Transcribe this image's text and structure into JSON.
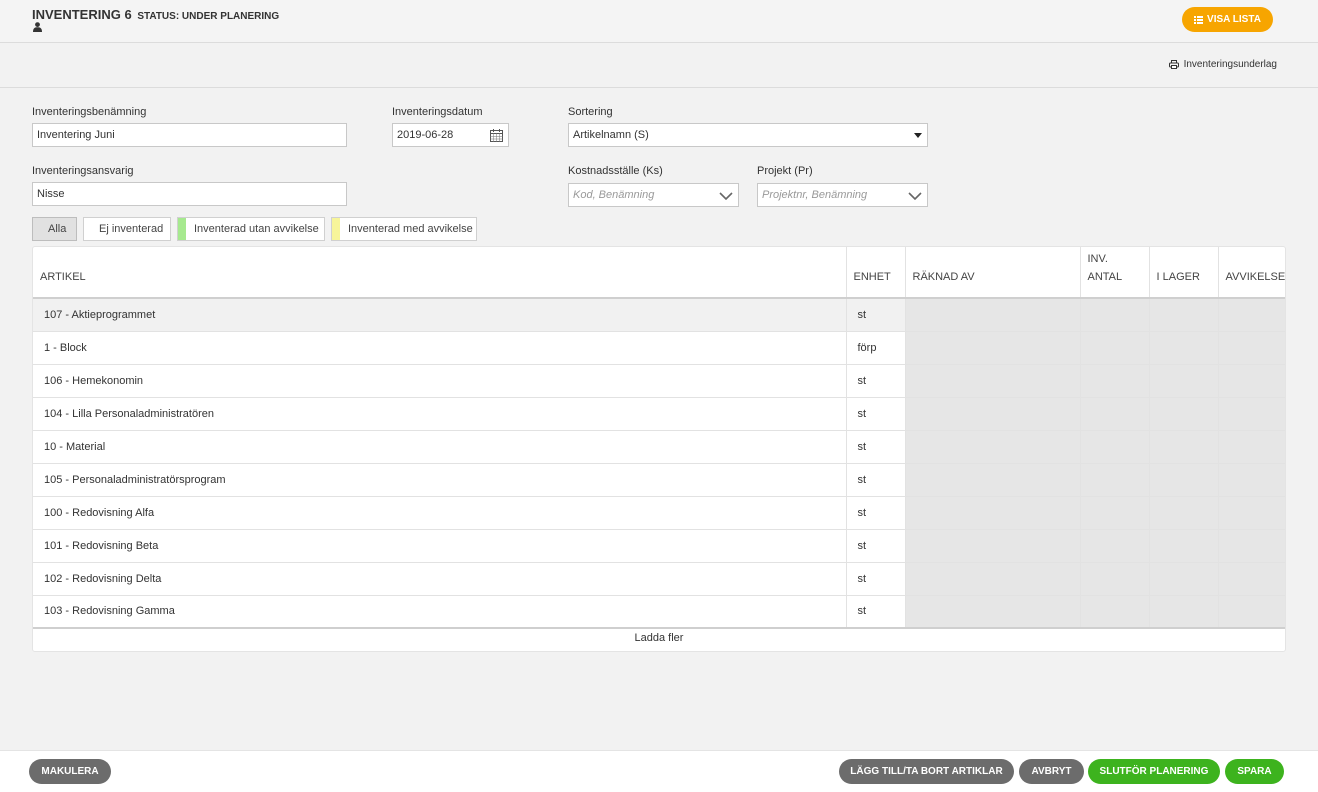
{
  "header": {
    "title": "INVENTERING 6",
    "status": "STATUS: UNDER PLANERING",
    "show_list_label": "VISA LISTA",
    "user_icon": "user-icon",
    "list_icon": "list-icon"
  },
  "toolbar": {
    "print_label": "Inventeringsunderlag",
    "print_icon": "printer-icon"
  },
  "form": {
    "name_label": "Inventeringsbenämning",
    "name_value": "Inventering Juni",
    "date_label": "Inventeringsdatum",
    "date_value": "2019-06-28",
    "sort_label": "Sortering",
    "sort_value": "Artikelnamn (S)",
    "responsible_label": "Inventeringsansvarig",
    "responsible_value": "Nisse",
    "cost_center_label": "Kostnadsställe (Ks)",
    "cost_center_placeholder": "Kod, Benämning",
    "project_label": "Projekt (Pr)",
    "project_placeholder": "Projektnr, Benämning"
  },
  "filters": [
    {
      "label": "Alla",
      "color": ""
    },
    {
      "label": "Ej inventerad",
      "color": ""
    },
    {
      "label": "Inventerad utan avvikelse",
      "color": "#a6e98f"
    },
    {
      "label": "Inventerad med avvikelse",
      "color": "#f7f59a"
    }
  ],
  "table": {
    "columns": [
      "ARTIKEL",
      "ENHET",
      "RÄKNAD AV",
      "INV. ANTAL",
      "I LAGER",
      "AVVIKELSE"
    ],
    "rows": [
      {
        "article": "107 - Aktieprogrammet",
        "unit": "st"
      },
      {
        "article": "1 - Block",
        "unit": "förp"
      },
      {
        "article": "106 - Hemekonomin",
        "unit": "st"
      },
      {
        "article": "104 - Lilla Personaladministratören",
        "unit": "st"
      },
      {
        "article": "10 - Material",
        "unit": "st"
      },
      {
        "article": "105 - Personaladministratörsprogram",
        "unit": "st"
      },
      {
        "article": "100 - Redovisning Alfa",
        "unit": "st"
      },
      {
        "article": "101 - Redovisning Beta",
        "unit": "st"
      },
      {
        "article": "102 - Redovisning Delta",
        "unit": "st"
      },
      {
        "article": "103 - Redovisning Gamma",
        "unit": "st"
      }
    ],
    "load_more": "Ladda fler"
  },
  "footer": {
    "cancel_doc": "MAKULERA",
    "add_remove": "LÄGG TILL/TA BORT ARTIKLAR",
    "abort": "AVBRYT",
    "finish": "SLUTFÖR PLANERING",
    "save": "SPARA"
  },
  "colors": {
    "accent_orange": "#f7a500",
    "green": "#3db31e",
    "dark_gray": "#6c6c6c"
  }
}
